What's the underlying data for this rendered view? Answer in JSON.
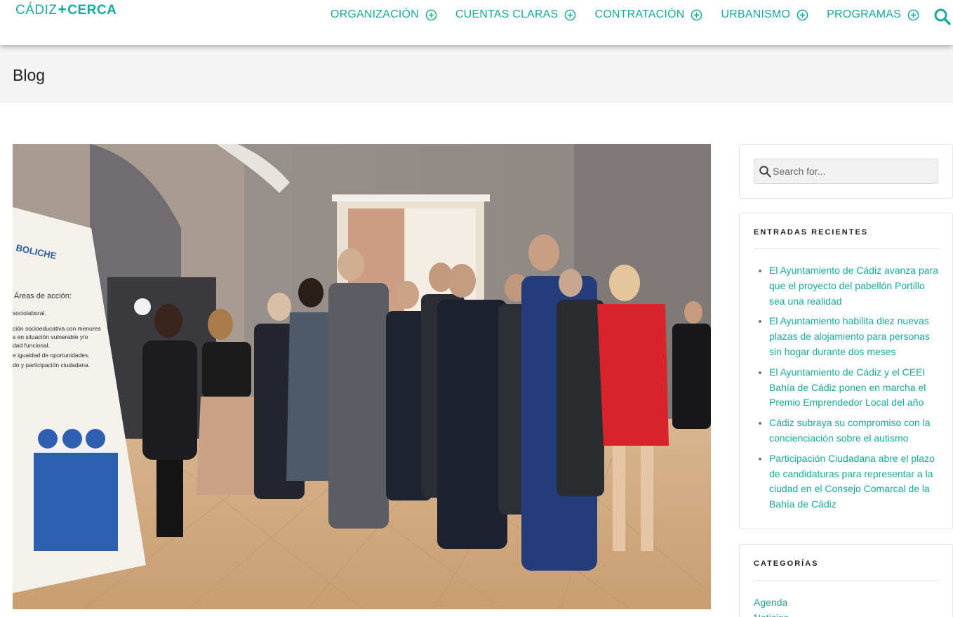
{
  "logo": {
    "part1": "CÁDIZ",
    "plus": "+",
    "part2": "CERCA"
  },
  "nav": {
    "items": [
      {
        "label": "ORGANIZACIÓN"
      },
      {
        "label": "CUENTAS CLARAS"
      },
      {
        "label": "CONTRATACIÓN"
      },
      {
        "label": "URBANISMO"
      },
      {
        "label": "PROGRAMAS"
      }
    ]
  },
  "page": {
    "title": "Blog"
  },
  "featured_image": {
    "poster_brand": "BOLICHE",
    "poster_heading": "Áreas de acción:",
    "poster_lines": [
      "sociolaboral.",
      "ción socioeducativa con menores",
      "s en situación vulnerable y/o",
      "dad funcional.",
      "e igualdad de oportunidades.",
      "do y participación ciudadana."
    ]
  },
  "sidebar": {
    "search": {
      "placeholder": "Search for..."
    },
    "recent": {
      "title": "ENTRADAS RECIENTES",
      "items": [
        "El Ayuntamiento de Cádiz avanza para que el proyecto del pabellón Portillo sea una realidad",
        "El Ayuntamiento habilita diez nuevas plazas de alojamiento para personas sin hogar durante dos meses",
        "El Ayuntamiento de Cádiz y el CEEI Bahía de Cádiz ponen en marcha el Premio Emprendedor Local del año",
        "Cádiz subraya su compromiso con la concienciación sobre el autismo",
        "Participación Ciudadana abre el plazo de candidaturas para representar a la ciudad en el Consejo Comarcal de la Bahía de Cádiz"
      ]
    },
    "categories": {
      "title": "CATEGORÍAS",
      "items": [
        "Agenda",
        "Noticias"
      ]
    }
  },
  "colors": {
    "accent": "#17a99a",
    "title_bar": "#f4f4f4"
  }
}
